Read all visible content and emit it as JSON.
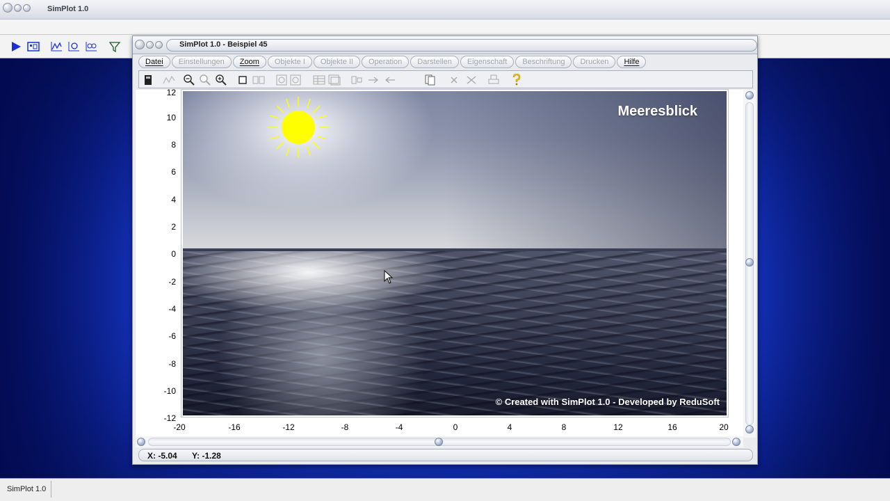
{
  "app": {
    "title": "SimPlot 1.0",
    "status_text": "SimPlot 1.0"
  },
  "inner_window": {
    "title": "SimPlot 1.0 - Beispiel 45",
    "menu": [
      {
        "label": "Datei",
        "enabled": true
      },
      {
        "label": "Einstellungen",
        "enabled": false
      },
      {
        "label": "Zoom",
        "enabled": true
      },
      {
        "label": "Objekte I",
        "enabled": false
      },
      {
        "label": "Objekte II",
        "enabled": false
      },
      {
        "label": "Operation",
        "enabled": false
      },
      {
        "label": "Darstellen",
        "enabled": false
      },
      {
        "label": "Eigenschaft",
        "enabled": false
      },
      {
        "label": "Beschriftung",
        "enabled": false
      },
      {
        "label": "Drucken",
        "enabled": false
      },
      {
        "label": "Hilfe",
        "enabled": true
      }
    ]
  },
  "plot": {
    "title": "Meeresblick",
    "credit": "© Created with SimPlot 1.0 - Developed by ReduSoft",
    "y_ticks": [
      "12",
      "10",
      "8",
      "6",
      "4",
      "2",
      "0",
      "-2",
      "-4",
      "-6",
      "-8",
      "-10",
      "-12"
    ],
    "x_ticks": [
      "-20",
      "-16",
      "-12",
      "-8",
      "-4",
      "0",
      "4",
      "8",
      "12",
      "16",
      "20"
    ]
  },
  "coordinates": {
    "x_label": "X: -5.04",
    "y_label": "Y: -1.28"
  },
  "colors": {
    "sun": "#ffff00",
    "desktop": "#1638c8"
  },
  "icons": {
    "app_toolbar": [
      "play-icon",
      "calculator-icon",
      "graph-icon",
      "parametric-graph-icon",
      "table-graph-icon",
      "filter-icon"
    ],
    "inner_toolbar": [
      "device-icon",
      "measure-icon",
      "zoom-out-icon",
      "zoom-reset-icon",
      "zoom-in-icon",
      "rectangle-icon",
      "grid-icon",
      "copy-left-icon",
      "copy-right-icon",
      "table-icon",
      "image-icon",
      "split-icon",
      "arrow-right-icon",
      "arrow-left-icon",
      "pages-icon",
      "delete-icon",
      "delete-all-icon",
      "print-icon",
      "help-icon"
    ]
  }
}
